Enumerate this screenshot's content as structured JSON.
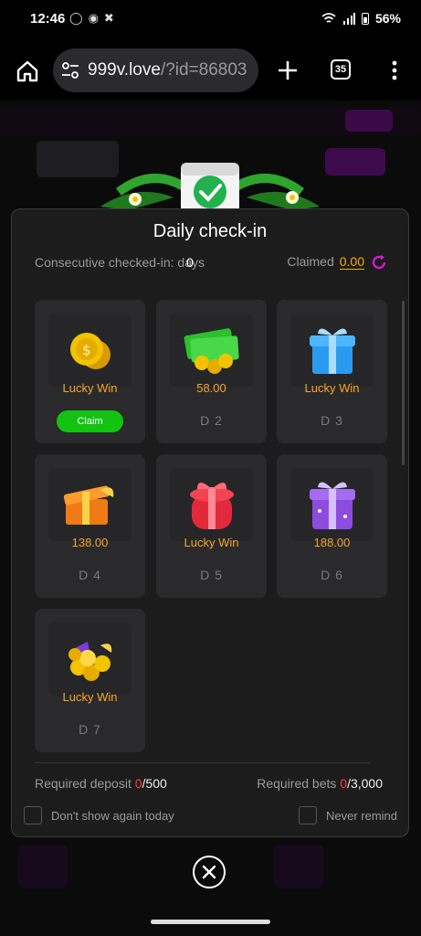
{
  "status": {
    "time": "12:46",
    "battery": "56%"
  },
  "browser": {
    "url_host": "999v.love",
    "url_path": "/?id=86803",
    "tab_count": "35"
  },
  "modal": {
    "title": "Daily check-in",
    "consecutive_label": "Consecutive checked-in: days",
    "consecutive_count": "0",
    "claimed_label": "Claimed",
    "claimed_amount": "0.00",
    "cards": [
      {
        "label": "Lucky Win",
        "day": "",
        "claim": "Claim",
        "icon": "coins-icon"
      },
      {
        "label": "58.00",
        "day": "D 2",
        "icon": "cash-coins-icon"
      },
      {
        "label": "Lucky Win",
        "day": "D 3",
        "icon": "blue-gift-icon"
      },
      {
        "label": "138.00",
        "day": "D 4",
        "icon": "orange-gift-icon"
      },
      {
        "label": "Lucky Win",
        "day": "D 5",
        "icon": "red-gift-icon"
      },
      {
        "label": "188.00",
        "day": "D 6",
        "icon": "purple-gift-icon"
      },
      {
        "label": "Lucky Win",
        "day": "D 7",
        "icon": "gold-pile-icon"
      }
    ],
    "required_deposit_label": "Required deposit",
    "required_deposit_current": "0",
    "required_deposit_target": "/500",
    "required_bets_label": "Required bets",
    "required_bets_current": "0",
    "required_bets_target": "/3,000",
    "dont_show_label": "Don't show again today",
    "never_remind_label": "Never remind"
  },
  "colors": {
    "accent": "#f5a524",
    "claim": "#12c312",
    "danger": "#ff3b3b",
    "refresh": "#d21ad2"
  }
}
